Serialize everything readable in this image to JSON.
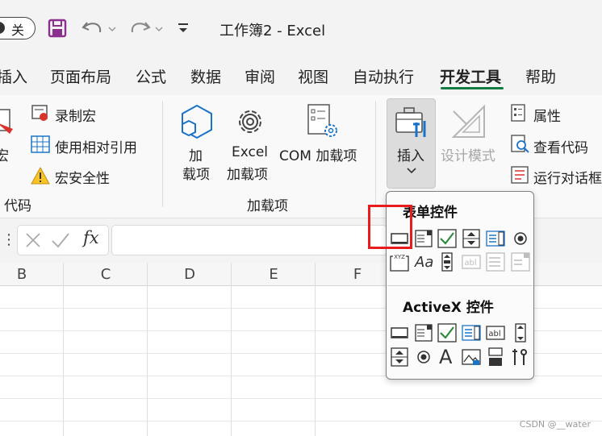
{
  "titlebar": {
    "autosave_label": "关",
    "window_title": "工作簿2  -  Excel"
  },
  "tabs": [
    "插入",
    "页面布局",
    "公式",
    "数据",
    "审阅",
    "视图",
    "自动执行",
    "开发工具",
    "帮助"
  ],
  "active_tab": "开发工具",
  "ribbon": {
    "code_group": {
      "macro_partial": "宏",
      "record_macro": "录制宏",
      "use_relative": "使用相对引用",
      "macro_security": "宏安全性",
      "group_label": "代码"
    },
    "addins_group": {
      "addins_line1": "加",
      "addins_line2": "载项",
      "excel_addins_line1": "Excel",
      "excel_addins_line2": "加载项",
      "com_addins": "COM 加载项",
      "group_label": "加载项"
    },
    "controls_group": {
      "insert": "插入",
      "design_mode": "设计模式",
      "properties": "属性",
      "view_code": "查看代码",
      "run_dialog": "运行对话框"
    }
  },
  "formula_bar": {
    "fx_label": "fx"
  },
  "columns": [
    "B",
    "C",
    "D",
    "E",
    "F"
  ],
  "dropdown": {
    "form_controls_title": "表单控件",
    "activex_title": "ActiveX 控件",
    "xyz_label": "XYZ"
  },
  "watermark": "CSDN @__water",
  "colors": {
    "accent_green": "#107c41",
    "highlight_red": "#e81c1c",
    "icon_blue": "#1a73c8",
    "check_green": "#2e8b3e",
    "purple": "#8b2f8f"
  }
}
